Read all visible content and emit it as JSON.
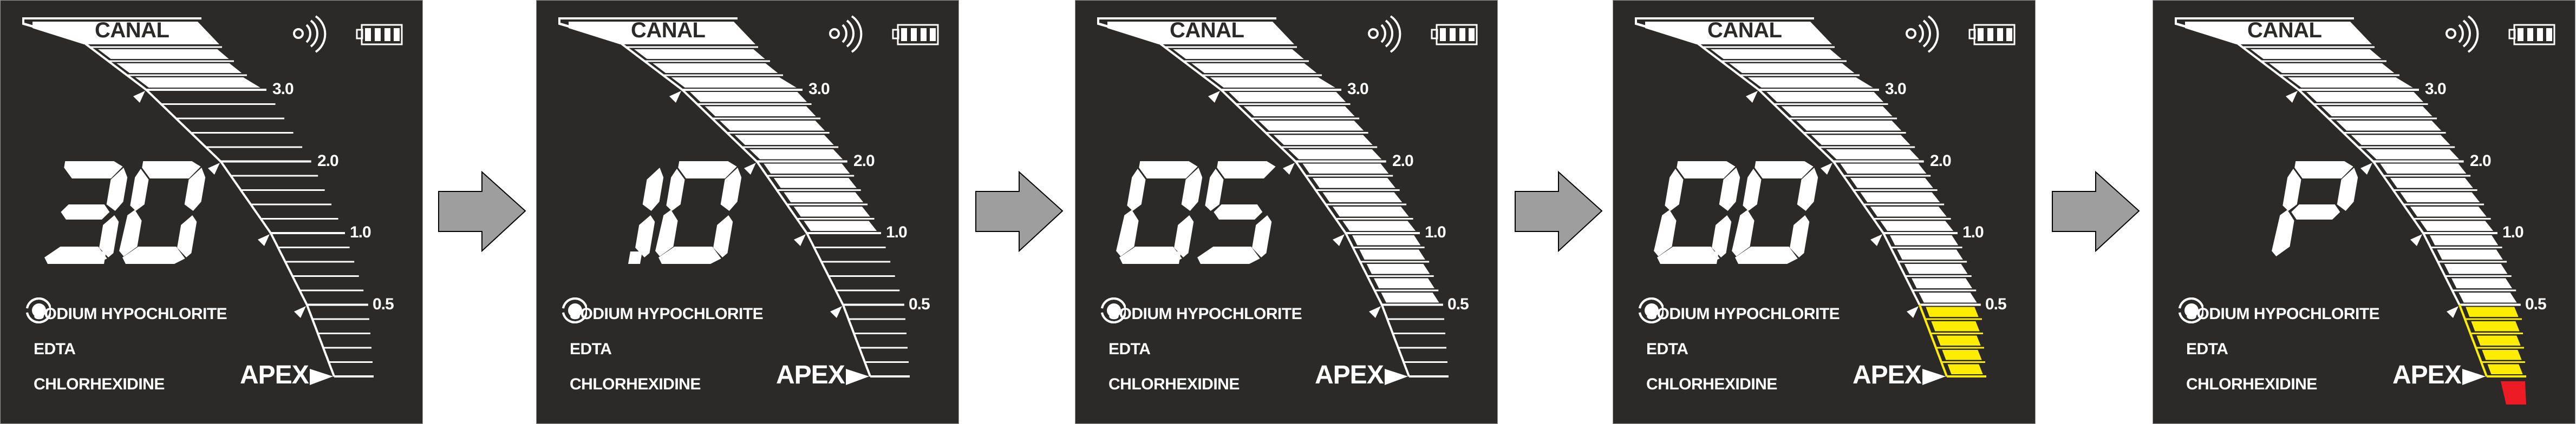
{
  "colors": {
    "panel_bg": "#2b2a29",
    "segment_on": "#ffffff",
    "warning": "#ffed00",
    "overshoot": "#ed1c24",
    "arrow_fill": "#9d9e9d"
  },
  "scale": {
    "top_label": "CANAL",
    "apex_label": "APEX",
    "ticks": [
      "3.0",
      "2.0",
      "1.0",
      "0.5"
    ],
    "segments_below_3": 20,
    "top_segments": 4
  },
  "icons": [
    "sensor-signal-icon",
    "battery-full-icon"
  ],
  "solutions": [
    {
      "label": "SODIUM HYPOCHLORITE",
      "selected": true
    },
    {
      "label": "EDTA",
      "selected": false
    },
    {
      "label": "CHLORHEXIDINE",
      "selected": false
    }
  ],
  "panels": [
    {
      "display": "3.0",
      "filled_white": 0,
      "filled_yellow": 0,
      "overshoot": false
    },
    {
      "display": "1.0",
      "filled_white": 10,
      "filled_yellow": 0,
      "overshoot": false
    },
    {
      "display": "0.5",
      "filled_white": 15,
      "filled_yellow": 0,
      "overshoot": false
    },
    {
      "display": "0.0",
      "filled_white": 15,
      "filled_yellow": 5,
      "overshoot": false
    },
    {
      "display": "P",
      "filled_white": 15,
      "filled_yellow": 5,
      "overshoot": true
    }
  ]
}
